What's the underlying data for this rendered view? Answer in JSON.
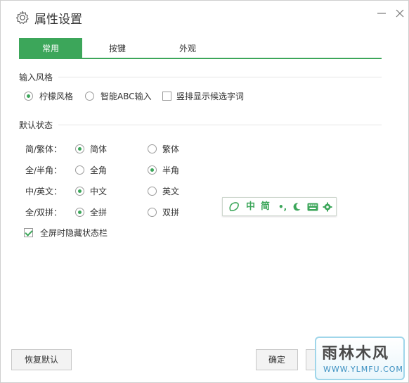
{
  "window": {
    "title": "属性设置"
  },
  "tabs": [
    {
      "label": "常用",
      "active": true
    },
    {
      "label": "按键",
      "active": false
    },
    {
      "label": "外观",
      "active": false
    }
  ],
  "input_style": {
    "section_title": "输入风格",
    "options": [
      {
        "label": "柠檬风格",
        "type": "radio",
        "checked": true
      },
      {
        "label": "智能ABC输入",
        "type": "radio",
        "checked": false
      },
      {
        "label": "竖排显示候选字词",
        "type": "checkbox",
        "checked": false
      }
    ]
  },
  "default_state": {
    "section_title": "默认状态",
    "rows": [
      {
        "label": "简/繁体：",
        "option_a": "简体",
        "option_b": "繁体",
        "selected": "a"
      },
      {
        "label": "全/半角：",
        "option_a": "全角",
        "option_b": "半角",
        "selected": "b"
      },
      {
        "label": "中/英文：",
        "option_a": "中文",
        "option_b": "英文",
        "selected": "a"
      },
      {
        "label": "全/双拼：",
        "option_a": "全拼",
        "option_b": "双拼",
        "selected": "a"
      }
    ],
    "hide_statusbar_label": "全屏时隐藏状态栏",
    "hide_statusbar_checked": true
  },
  "status_bar_preview": {
    "lang": "中",
    "script": "简",
    "punct": "•,"
  },
  "buttons": {
    "restore_default": "恢复默认",
    "ok": "确定"
  },
  "watermark": {
    "main": "雨林木风",
    "sub": "WWW.YLMFU.COM"
  },
  "colors": {
    "accent": "#3ca65a"
  }
}
